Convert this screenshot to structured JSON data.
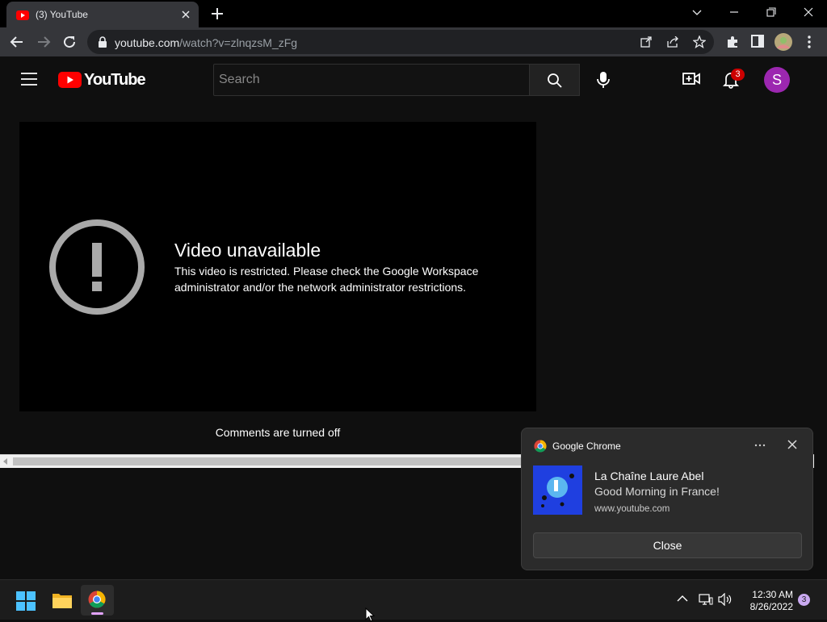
{
  "browser": {
    "tab_title": "(3) YouTube",
    "url_host": "youtube.com",
    "url_path": "/watch?v=zlnqzsM_zFg"
  },
  "youtube": {
    "logo_text": "YouTube",
    "search_placeholder": "Search",
    "notification_count": "3",
    "avatar_letter": "S"
  },
  "player": {
    "headline": "Video unavailable",
    "message": "This video is restricted. Please check the Google Workspace administrator and/or the network administrator restrictions."
  },
  "comments": {
    "status": "Comments are turned off"
  },
  "toast": {
    "app_name": "Google Chrome",
    "sender": "La Chaîne Laure Abel",
    "body": "Good Morning in France!",
    "source": "www.youtube.com",
    "close_label": "Close"
  },
  "taskbar": {
    "time": "12:30 AM",
    "date": "8/26/2022",
    "notification_badge": "3"
  },
  "colors": {
    "youtube_red": "#ff0000",
    "avatar_purple": "#9c27b0",
    "badge_red": "#cc0000"
  }
}
